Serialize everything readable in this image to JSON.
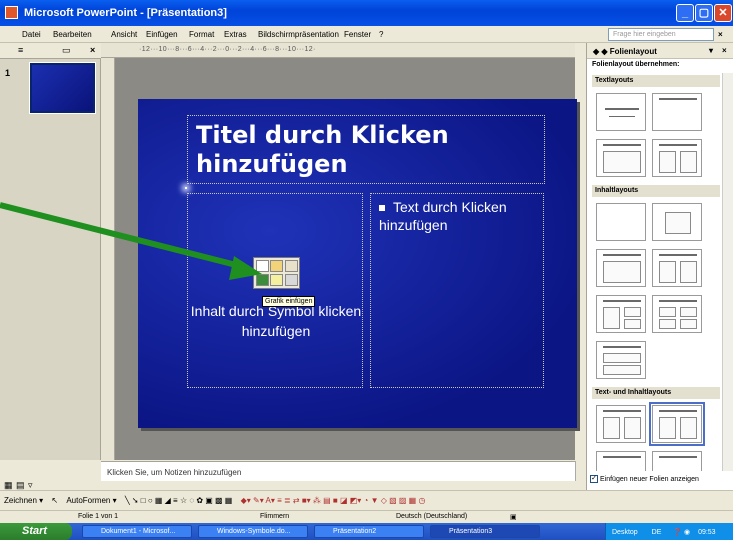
{
  "window": {
    "title": "Microsoft PowerPoint - [Präsentation3]"
  },
  "menu": {
    "items": [
      "Datei",
      "Bearbeiten",
      "Ansicht",
      "Einfügen",
      "Format",
      "Extras",
      "Bildschirmpräsentation",
      "Fenster",
      "?"
    ],
    "help_placeholder": "Frage hier eingeben"
  },
  "outline": {
    "slide_number": "1"
  },
  "ruler": {
    "marks": "·12···10···8···6···4···2···0···2···4···6···8···10···12·"
  },
  "slide": {
    "title": "Titel durch Klicken hinzufügen",
    "left_placeholder": "Inhalt durch Symbol klicken hinzufügen",
    "right_bullet": "Text durch Klicken hinzufügen",
    "tooltip": "Grafik einfügen"
  },
  "notes": {
    "placeholder": "Klicken Sie, um Notizen hinzuzufügen"
  },
  "taskpane": {
    "title": "Folienlayout",
    "subtitle": "Folienlayout übernehmen:",
    "sections": [
      "Textlayouts",
      "Inhaltlayouts",
      "Text- und Inhaltlayouts"
    ],
    "checkbox_label": "Einfügen neuer Folien anzeigen"
  },
  "drawbar": {
    "zeichnen": "Zeichnen ▾",
    "autoformen": "AutoFormen ▾"
  },
  "status": {
    "slide": "Folie 1 von 1",
    "design": "Flimmern",
    "language": "Deutsch (Deutschland)"
  },
  "taskbar": {
    "start": "Start",
    "buttons": [
      "Dokument1 - Microsof...",
      "Windows-Symbole.do...",
      "Präsentation2",
      "Präsentation3"
    ],
    "desktop": "Desktop",
    "lang": "DE",
    "clock": "09:53"
  },
  "colors": {
    "slide_bg": "#0b1584",
    "arrow": "#1f8f1f",
    "titlebar": "#0a5ff0"
  }
}
